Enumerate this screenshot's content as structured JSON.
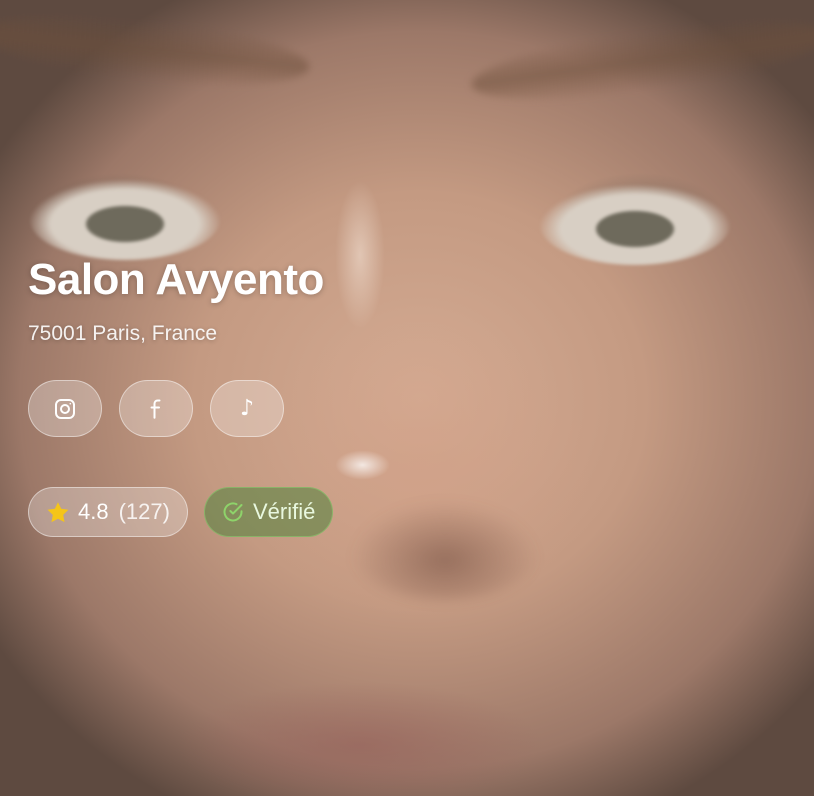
{
  "salon": {
    "name": "Salon Avyento",
    "address": "75001 Paris, France"
  },
  "socials": [
    {
      "icon": "instagram-icon"
    },
    {
      "icon": "facebook-icon",
      "glyph": "f"
    },
    {
      "icon": "tiktok-icon",
      "glyph": "♪"
    }
  ],
  "rating": {
    "value": "4.8",
    "count": "(127)",
    "icon": "star-icon",
    "star_color": "#f5c518"
  },
  "verified": {
    "label": "Vérifié",
    "icon": "check-circle-icon",
    "color": "#8ed36a"
  }
}
